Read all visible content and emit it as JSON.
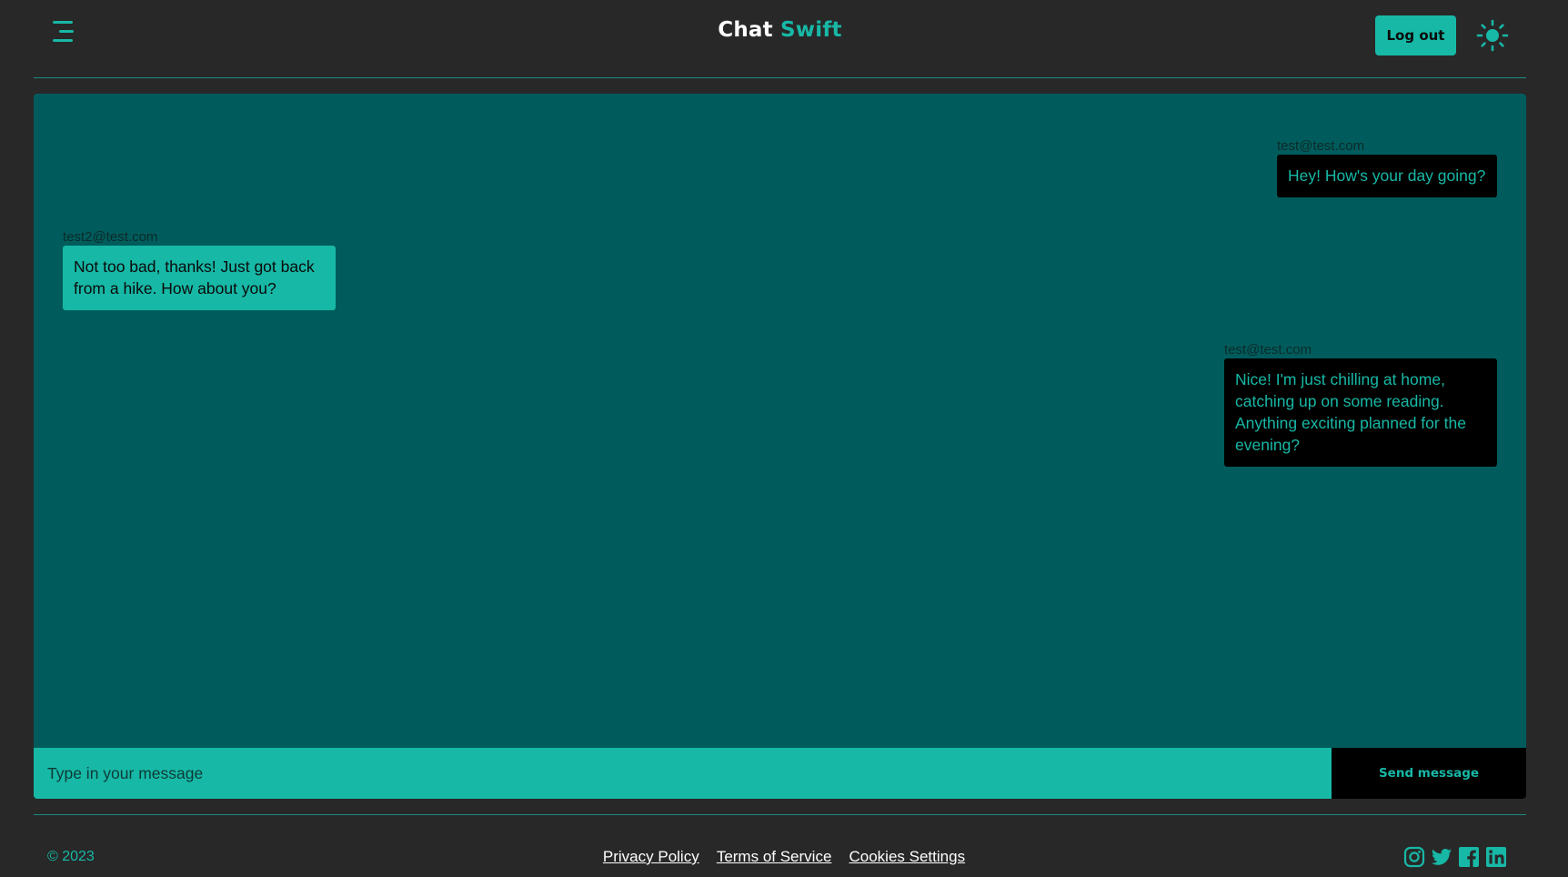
{
  "header": {
    "brand_part1": "Chat",
    "brand_part2": "Swift",
    "logout_label": "Log out",
    "menu_icon": "hamburger-menu-icon",
    "theme_icon": "sun-icon"
  },
  "messages": [
    {
      "sender": "test@test.com",
      "text": "Hey! How's your day going?",
      "mine": true
    },
    {
      "sender": "test2@test.com",
      "text": "Not too bad, thanks! Just got back from a hike. How about you?",
      "mine": false
    },
    {
      "sender": "test@test.com",
      "text": "Nice! I'm just chilling at home, catching up on some reading. Anything exciting planned for the evening?",
      "mine": true
    }
  ],
  "composer": {
    "placeholder": "Type in your message",
    "value": "",
    "send_label": "Send message"
  },
  "footer": {
    "copyright": "© 2023",
    "links": [
      "Privacy Policy",
      "Terms of Service",
      "Cookies Settings"
    ],
    "socials": [
      "instagram-icon",
      "twitter-icon",
      "facebook-icon",
      "linkedin-icon"
    ]
  },
  "colors": {
    "background": "#282828",
    "accent": "#17b8a6",
    "panel": "#005c5c",
    "own_bubble": "#000000"
  }
}
